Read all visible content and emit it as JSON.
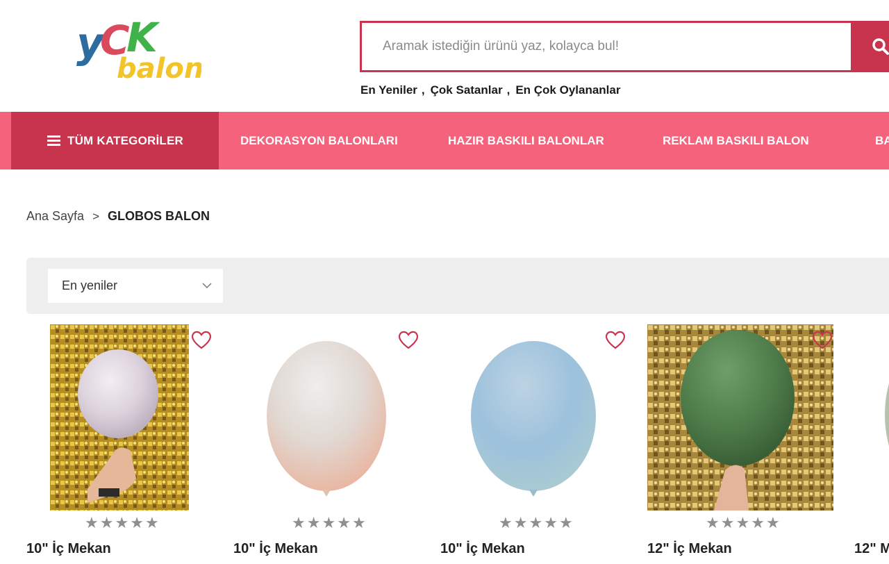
{
  "brand": {
    "logo_top": "YCK",
    "logo_bottom": "balon"
  },
  "search": {
    "placeholder": "Aramak istediğin ürünü yaz, kolayca bul!",
    "button_icon": "search-icon"
  },
  "quick_links": [
    {
      "label": "En Yeniler"
    },
    {
      "label": "Çok Satanlar"
    },
    {
      "label": "En Çok Oylananlar"
    }
  ],
  "quick_links_separator": ",",
  "nav": {
    "all_categories": "TÜM KATEGORİLER",
    "items": [
      {
        "label": "DEKORASYON BALONLARI"
      },
      {
        "label": "HAZIR BASKILI BALONLAR"
      },
      {
        "label": "REKLAM BASKILI BALON"
      },
      {
        "label": "BA"
      }
    ],
    "colors": {
      "bar": "#f4637b",
      "active": "#c8334e"
    }
  },
  "breadcrumb": {
    "home": "Ana Sayfa",
    "separator": ">",
    "current": "GLOBOS BALON"
  },
  "sort": {
    "selected": "En yeniler"
  },
  "products": [
    {
      "title": "10\" İç Mekan",
      "rating": 0,
      "image": "pastel-pink-balloon-gold-backdrop",
      "favorite_icon": "heart-icon"
    },
    {
      "title": "10\" İç Mekan",
      "rating": 0,
      "image": "pastel-peach-balloon",
      "favorite_icon": "heart-icon"
    },
    {
      "title": "10\" İç Mekan",
      "rating": 0,
      "image": "pastel-blue-balloon",
      "favorite_icon": "heart-icon"
    },
    {
      "title": "12\" İç Mekan",
      "rating": 0,
      "image": "green-balloon-gold-backdrop",
      "favorite_icon": "heart-icon"
    },
    {
      "title": "12\" M",
      "rating": 0,
      "image": "sage-balloon",
      "favorite_icon": "heart-icon"
    }
  ],
  "colors": {
    "accent": "#c8334e",
    "nav_pink": "#f4637b",
    "star_gray": "#8f8f8f"
  }
}
